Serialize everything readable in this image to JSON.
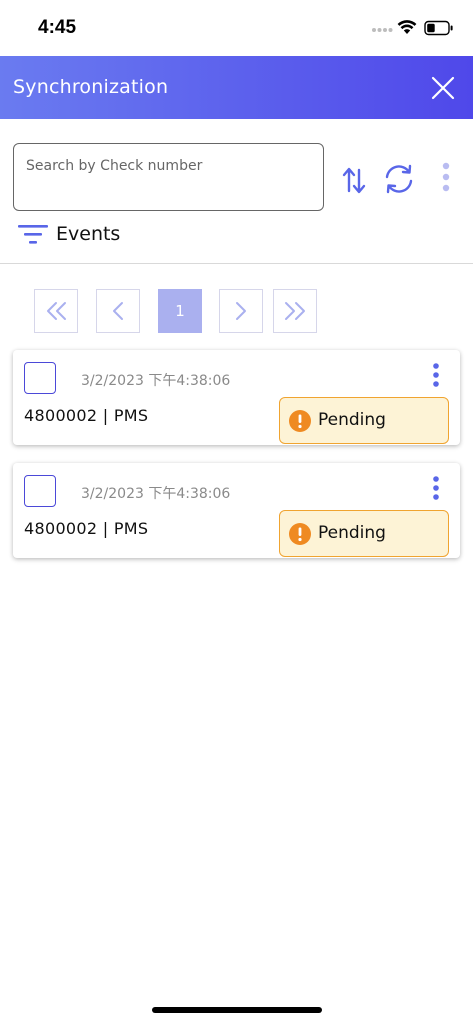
{
  "status_bar": {
    "time": "4:45"
  },
  "app_bar": {
    "title": "Synchronization"
  },
  "search": {
    "placeholder": "Search by Check number",
    "value": ""
  },
  "filter": {
    "label": "Events"
  },
  "pagination": {
    "current_page": "1"
  },
  "events": [
    {
      "timestamp": "3/2/2023 下午4:38:06",
      "title": "4800002 | PMS",
      "status": "Pending"
    },
    {
      "timestamp": "3/2/2023 下午4:38:06",
      "title": "4800002 | PMS",
      "status": "Pending"
    }
  ],
  "colors": {
    "accent": "#4f48ea",
    "accent_light": "#aab0ef",
    "pending_bg": "#fdf3d6",
    "pending_border": "#f0a430",
    "pending_icon": "#ef8a22"
  }
}
